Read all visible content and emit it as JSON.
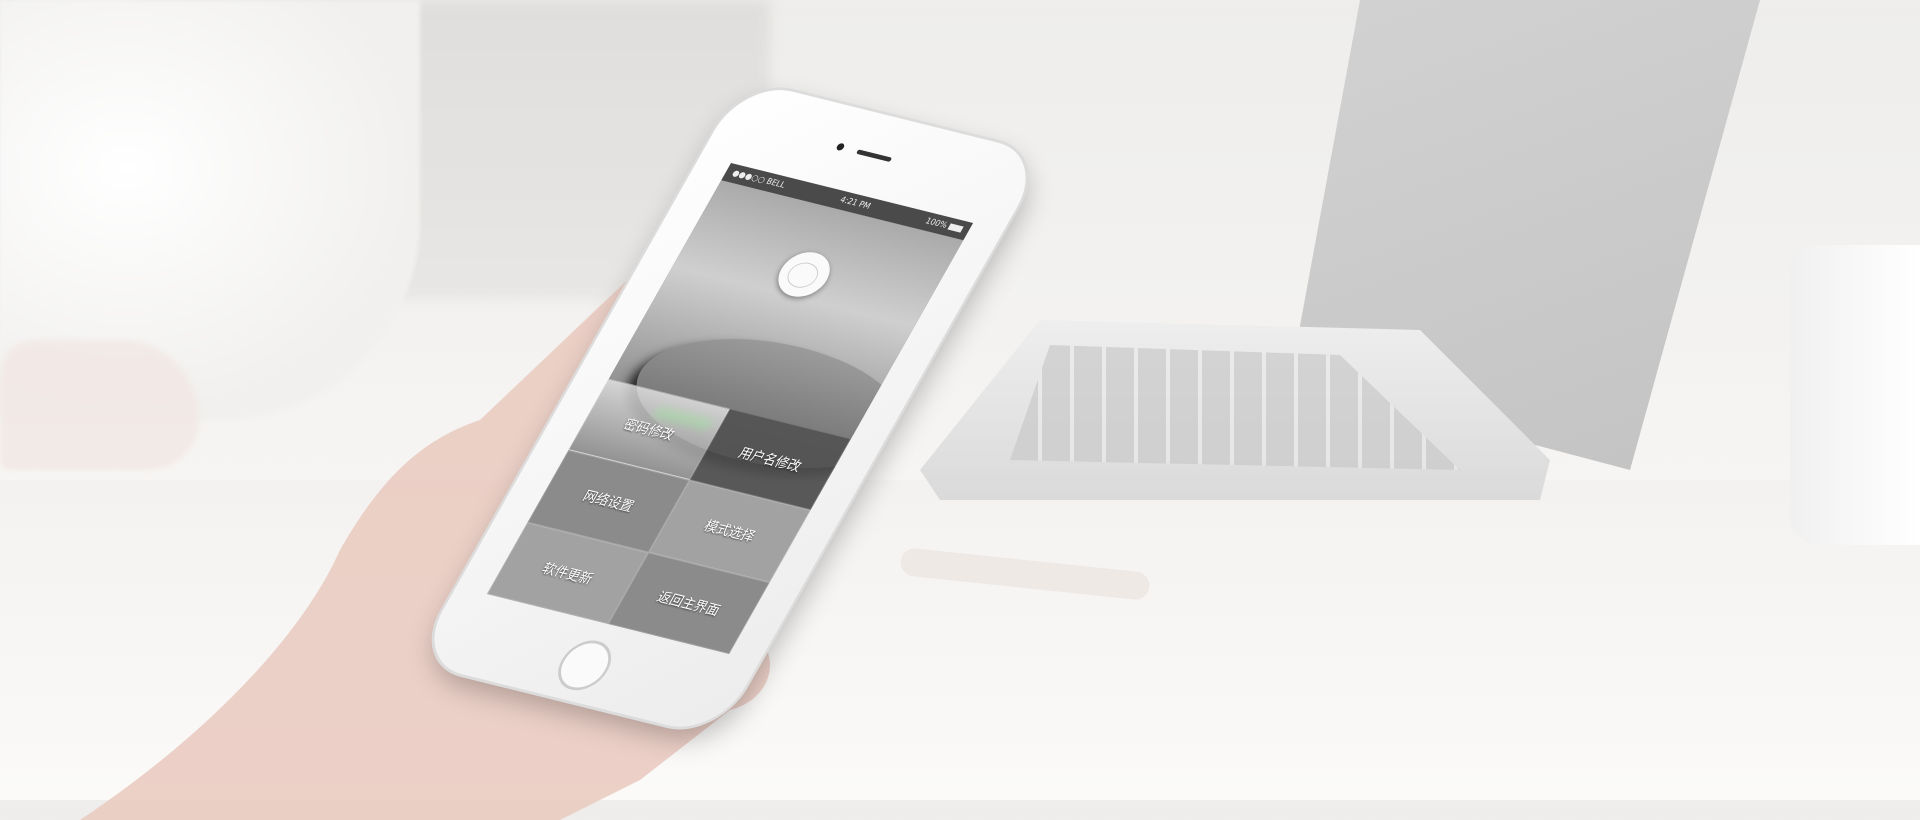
{
  "status_bar": {
    "carrier": "●●●○○ BELL",
    "time": "4:21 PM",
    "battery": "100%"
  },
  "menu": [
    {
      "label": "密码修改"
    },
    {
      "label": "用户名修改"
    },
    {
      "label": "网络设置"
    },
    {
      "label": "模式选择"
    },
    {
      "label": "软件更新"
    },
    {
      "label": "返回主界面"
    }
  ],
  "colors": {
    "led": "#2fc02f",
    "status_bar": "#4a4a4a"
  }
}
